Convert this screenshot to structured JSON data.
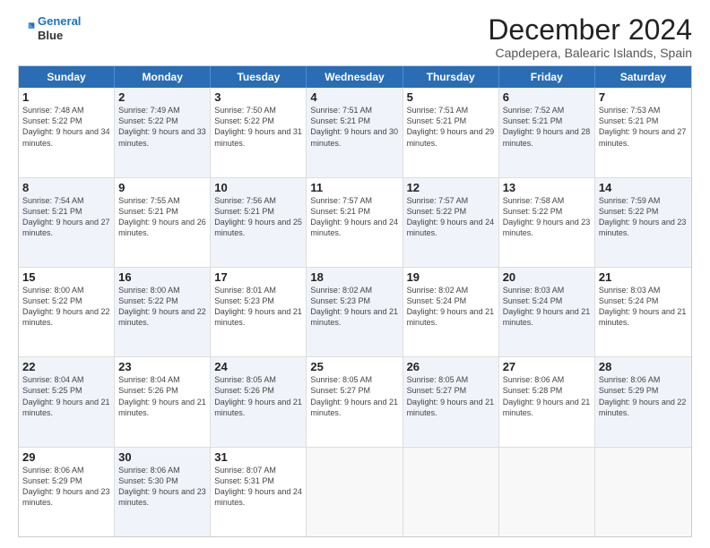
{
  "logo": {
    "line1": "General",
    "line2": "Blue"
  },
  "title": "December 2024",
  "subtitle": "Capdepera, Balearic Islands, Spain",
  "header": {
    "days": [
      "Sunday",
      "Monday",
      "Tuesday",
      "Wednesday",
      "Thursday",
      "Friday",
      "Saturday"
    ]
  },
  "weeks": [
    [
      {
        "day": "1",
        "rise": "7:48 AM",
        "set": "5:22 PM",
        "daylight": "9 hours and 34 minutes.",
        "bg": ""
      },
      {
        "day": "2",
        "rise": "7:49 AM",
        "set": "5:22 PM",
        "daylight": "9 hours and 33 minutes.",
        "bg": "alt"
      },
      {
        "day": "3",
        "rise": "7:50 AM",
        "set": "5:22 PM",
        "daylight": "9 hours and 31 minutes.",
        "bg": ""
      },
      {
        "day": "4",
        "rise": "7:51 AM",
        "set": "5:21 PM",
        "daylight": "9 hours and 30 minutes.",
        "bg": "alt"
      },
      {
        "day": "5",
        "rise": "7:51 AM",
        "set": "5:21 PM",
        "daylight": "9 hours and 29 minutes.",
        "bg": ""
      },
      {
        "day": "6",
        "rise": "7:52 AM",
        "set": "5:21 PM",
        "daylight": "9 hours and 28 minutes.",
        "bg": "alt"
      },
      {
        "day": "7",
        "rise": "7:53 AM",
        "set": "5:21 PM",
        "daylight": "9 hours and 27 minutes.",
        "bg": ""
      }
    ],
    [
      {
        "day": "8",
        "rise": "7:54 AM",
        "set": "5:21 PM",
        "daylight": "9 hours and 27 minutes.",
        "bg": "alt"
      },
      {
        "day": "9",
        "rise": "7:55 AM",
        "set": "5:21 PM",
        "daylight": "9 hours and 26 minutes.",
        "bg": ""
      },
      {
        "day": "10",
        "rise": "7:56 AM",
        "set": "5:21 PM",
        "daylight": "9 hours and 25 minutes.",
        "bg": "alt"
      },
      {
        "day": "11",
        "rise": "7:57 AM",
        "set": "5:21 PM",
        "daylight": "9 hours and 24 minutes.",
        "bg": ""
      },
      {
        "day": "12",
        "rise": "7:57 AM",
        "set": "5:22 PM",
        "daylight": "9 hours and 24 minutes.",
        "bg": "alt"
      },
      {
        "day": "13",
        "rise": "7:58 AM",
        "set": "5:22 PM",
        "daylight": "9 hours and 23 minutes.",
        "bg": ""
      },
      {
        "day": "14",
        "rise": "7:59 AM",
        "set": "5:22 PM",
        "daylight": "9 hours and 23 minutes.",
        "bg": "alt"
      }
    ],
    [
      {
        "day": "15",
        "rise": "8:00 AM",
        "set": "5:22 PM",
        "daylight": "9 hours and 22 minutes.",
        "bg": ""
      },
      {
        "day": "16",
        "rise": "8:00 AM",
        "set": "5:22 PM",
        "daylight": "9 hours and 22 minutes.",
        "bg": "alt"
      },
      {
        "day": "17",
        "rise": "8:01 AM",
        "set": "5:23 PM",
        "daylight": "9 hours and 21 minutes.",
        "bg": ""
      },
      {
        "day": "18",
        "rise": "8:02 AM",
        "set": "5:23 PM",
        "daylight": "9 hours and 21 minutes.",
        "bg": "alt"
      },
      {
        "day": "19",
        "rise": "8:02 AM",
        "set": "5:24 PM",
        "daylight": "9 hours and 21 minutes.",
        "bg": ""
      },
      {
        "day": "20",
        "rise": "8:03 AM",
        "set": "5:24 PM",
        "daylight": "9 hours and 21 minutes.",
        "bg": "alt"
      },
      {
        "day": "21",
        "rise": "8:03 AM",
        "set": "5:24 PM",
        "daylight": "9 hours and 21 minutes.",
        "bg": ""
      }
    ],
    [
      {
        "day": "22",
        "rise": "8:04 AM",
        "set": "5:25 PM",
        "daylight": "9 hours and 21 minutes.",
        "bg": "alt"
      },
      {
        "day": "23",
        "rise": "8:04 AM",
        "set": "5:26 PM",
        "daylight": "9 hours and 21 minutes.",
        "bg": ""
      },
      {
        "day": "24",
        "rise": "8:05 AM",
        "set": "5:26 PM",
        "daylight": "9 hours and 21 minutes.",
        "bg": "alt"
      },
      {
        "day": "25",
        "rise": "8:05 AM",
        "set": "5:27 PM",
        "daylight": "9 hours and 21 minutes.",
        "bg": ""
      },
      {
        "day": "26",
        "rise": "8:05 AM",
        "set": "5:27 PM",
        "daylight": "9 hours and 21 minutes.",
        "bg": "alt"
      },
      {
        "day": "27",
        "rise": "8:06 AM",
        "set": "5:28 PM",
        "daylight": "9 hours and 21 minutes.",
        "bg": ""
      },
      {
        "day": "28",
        "rise": "8:06 AM",
        "set": "5:29 PM",
        "daylight": "9 hours and 22 minutes.",
        "bg": "alt"
      }
    ],
    [
      {
        "day": "29",
        "rise": "8:06 AM",
        "set": "5:29 PM",
        "daylight": "9 hours and 23 minutes.",
        "bg": ""
      },
      {
        "day": "30",
        "rise": "8:06 AM",
        "set": "5:30 PM",
        "daylight": "9 hours and 23 minutes.",
        "bg": "alt"
      },
      {
        "day": "31",
        "rise": "8:07 AM",
        "set": "5:31 PM",
        "daylight": "9 hours and 24 minutes.",
        "bg": ""
      },
      {
        "day": "",
        "rise": "",
        "set": "",
        "daylight": "",
        "bg": "empty"
      },
      {
        "day": "",
        "rise": "",
        "set": "",
        "daylight": "",
        "bg": "empty"
      },
      {
        "day": "",
        "rise": "",
        "set": "",
        "daylight": "",
        "bg": "empty"
      },
      {
        "day": "",
        "rise": "",
        "set": "",
        "daylight": "",
        "bg": "empty"
      }
    ]
  ],
  "labels": {
    "sunrise": "Sunrise:",
    "sunset": "Sunset:",
    "daylight": "Daylight:"
  }
}
